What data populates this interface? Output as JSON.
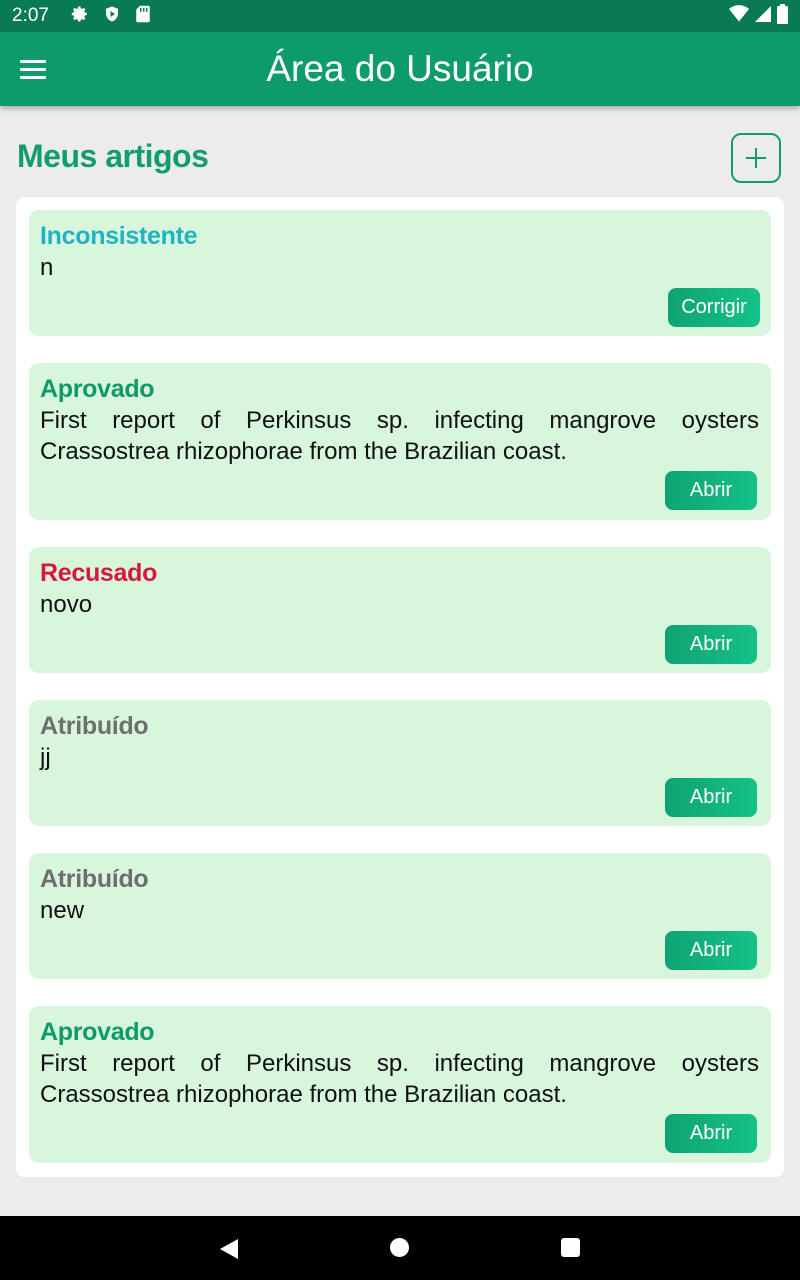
{
  "status_bar": {
    "time": "2:07",
    "icons": [
      "gear-icon",
      "shield-icon",
      "sd-card-icon",
      "wifi-icon",
      "signal-icon",
      "battery-icon"
    ]
  },
  "app_bar": {
    "title": "Área do Usuário",
    "menu_icon": "hamburger-menu-icon"
  },
  "section": {
    "title": "Meus artigos",
    "add_icon": "plus-icon"
  },
  "colors": {
    "primary": "#0d9b6c",
    "status_inconsistente": "#1fb3c4",
    "status_aprovado": "#0f9a6a",
    "status_recusado": "#d8173f",
    "status_atribuido": "#6f6f6f",
    "card_bg": "#d7f6dc"
  },
  "articles": [
    {
      "status": "Inconsistente",
      "title": "n",
      "action": "Corrigir"
    },
    {
      "status": "Aprovado",
      "title": "First report of Perkinsus sp. infecting mangrove oysters Crassostrea rhizophorae from the Brazilian coast.",
      "action": "Abrir"
    },
    {
      "status": "Recusado",
      "title": "novo",
      "action": "Abrir"
    },
    {
      "status": "Atribuído",
      "title": "jj",
      "action": "Abrir"
    },
    {
      "status": "Atribuído",
      "title": "new",
      "action": "Abrir"
    },
    {
      "status": "Aprovado",
      "title": "First report of Perkinsus sp. infecting mangrove oysters Crassostrea rhizophorae from the Brazilian coast.",
      "action": "Abrir"
    }
  ]
}
